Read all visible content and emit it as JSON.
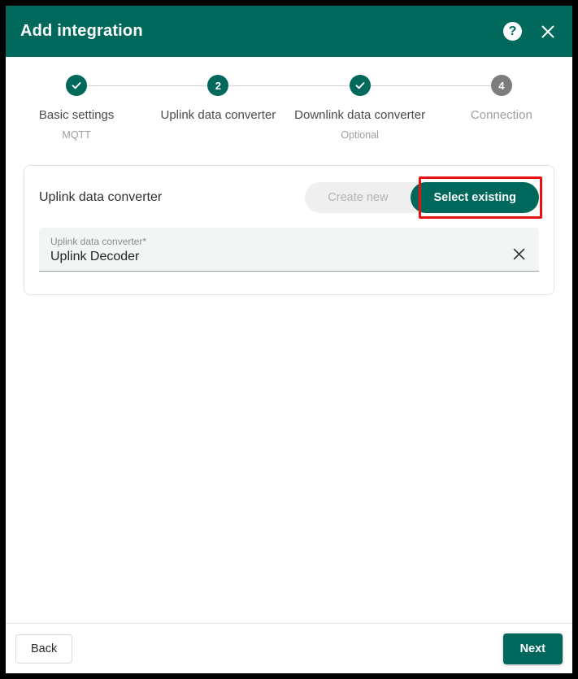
{
  "header": {
    "title": "Add integration",
    "help_icon": "help-circle-icon",
    "help_glyph": "?",
    "close_icon": "close-icon"
  },
  "stepper": {
    "steps": [
      {
        "label": "Basic settings",
        "sublabel": "MQTT",
        "marker": "✓",
        "state": "done"
      },
      {
        "label": "Uplink data converter",
        "sublabel": "",
        "marker": "2",
        "state": "active"
      },
      {
        "label": "Downlink data converter",
        "sublabel": "Optional",
        "marker": "✓",
        "state": "done"
      },
      {
        "label": "Connection",
        "sublabel": "",
        "marker": "4",
        "state": "todo"
      }
    ]
  },
  "card": {
    "title": "Uplink data converter",
    "toggle": {
      "create_new_label": "Create new",
      "select_existing_label": "Select existing",
      "selected": "Select existing"
    },
    "field": {
      "label": "Uplink data converter*",
      "value": "Uplink Decoder",
      "placeholder": "Uplink data converter",
      "clear_icon": "close-icon"
    }
  },
  "footer": {
    "back_label": "Back",
    "next_label": "Next"
  },
  "colors": {
    "header_green": "#00695c",
    "accent_green": "#00675b",
    "highlight_red": "#e81010",
    "step_todo_gray": "#7d7d7d",
    "field_bg": "#f1f5f4",
    "toggle_bg": "#efefef"
  }
}
